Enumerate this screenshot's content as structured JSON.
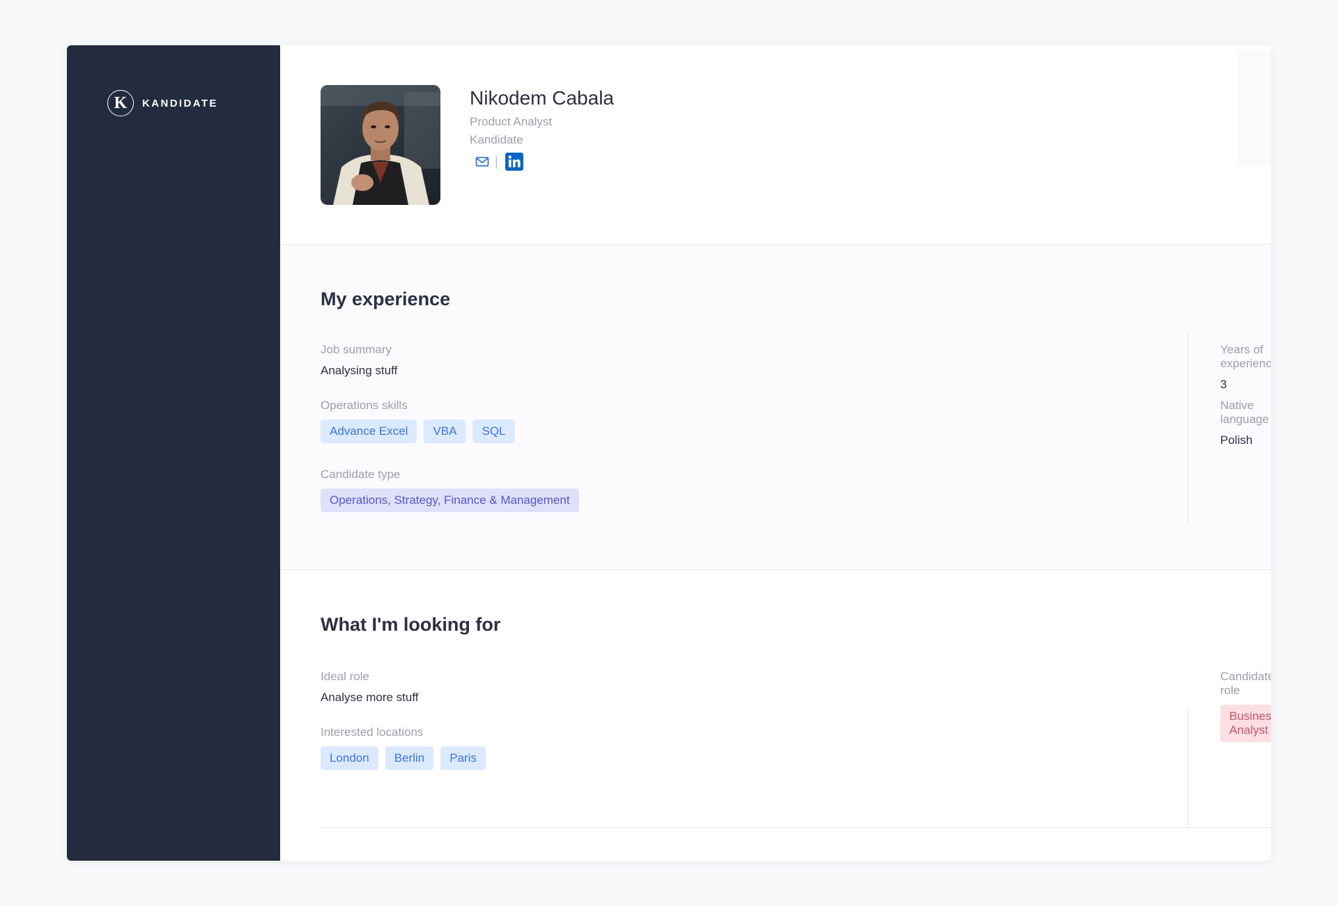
{
  "app": {
    "logo_letter": "K",
    "logo_text": "KANDIDATE"
  },
  "profile": {
    "name": "Nikodem Cabala",
    "title": "Product Analyst",
    "company": "Kandidate",
    "contact_separator": "|"
  },
  "experience": {
    "heading": "My experience",
    "job_summary_label": "Job summary",
    "job_summary_value": "Analysing stuff",
    "operations_skills_label": "Operations skills",
    "operations_skills": [
      "Advance Excel",
      "VBA",
      "SQL"
    ],
    "candidate_type_label": "Candidate type",
    "candidate_type": "Operations, Strategy, Finance & Management",
    "years_label": "Years of experience",
    "years_value": "3",
    "native_language_label": "Native language",
    "native_language_value": "Polish"
  },
  "looking_for": {
    "heading": "What I'm looking for",
    "ideal_role_label": "Ideal role",
    "ideal_role_value": "Analyse more stuff",
    "locations_label": "Interested locations",
    "locations": [
      "London",
      "Berlin",
      "Paris"
    ],
    "candidate_role_label": "Candidate's role",
    "candidate_role": "Business Analyst"
  },
  "colors": {
    "sidebar": "#232b3e",
    "tag_blue_bg": "#dceaff",
    "tag_blue_text": "#3d74d6",
    "tag_purple_bg": "#e0e0fb",
    "tag_pink_bg": "#fbdfe3",
    "linkedin": "#0a66c2"
  },
  "icons": {
    "email": "mail-icon",
    "linkedin": "linkedin-icon"
  }
}
